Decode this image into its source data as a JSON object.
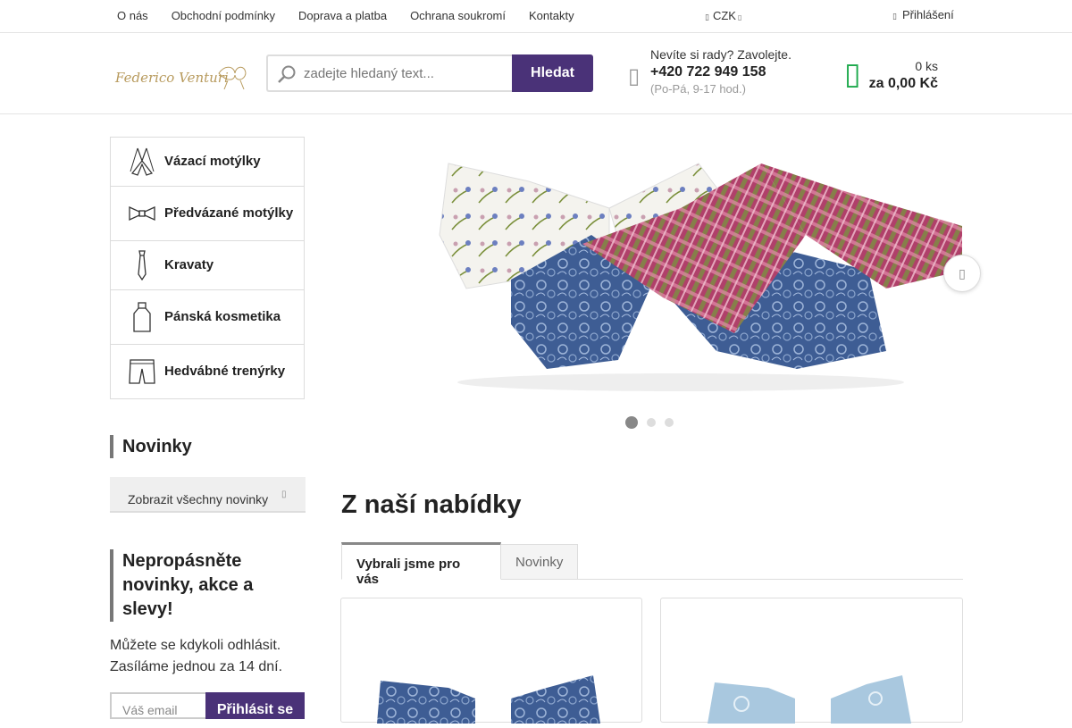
{
  "topnav": {
    "links": [
      "O nás",
      "Obchodní podmínky",
      "Doprava a platba",
      "Ochrana soukromí",
      "Kontakty"
    ],
    "currency": "CZK",
    "login": "Přihlášení"
  },
  "header": {
    "logo_text": "Federico Venturi",
    "search_placeholder": "zadejte hledaný text...",
    "search_button": "Hledat",
    "contact_question": "Nevíte si rady? Zavolejte.",
    "phone": "+420 722 949 158",
    "hours": "(Po-Pá, 9-17 hod.)",
    "cart_count": "0 ks",
    "cart_total": "za 0,00 Kč"
  },
  "categories": [
    {
      "label": "Vázací motýlky",
      "icon": "bow-tie-untied-icon"
    },
    {
      "label": "Předvázané motýlky",
      "icon": "bow-tie-icon"
    },
    {
      "label": "Kravaty",
      "icon": "necktie-icon"
    },
    {
      "label": "Pánská kosmetika",
      "icon": "cosmetics-bottle-icon"
    },
    {
      "label": "Hedvábné trenýrky",
      "icon": "boxer-shorts-icon"
    }
  ],
  "sidebar": {
    "news_title": "Novinky",
    "all_news": "Zobrazit všechny novinky",
    "newsletter_title": "Nepropásněte novinky, akce a slevy!",
    "newsletter_text1": "Můžete se kdykoli odhlásit.",
    "newsletter_text2": "Zasíláme jednou za 14 dní.",
    "email_placeholder": "Váš email",
    "subscribe_button": "Přihlásit se"
  },
  "slider": {
    "active_index": 0,
    "count": 3
  },
  "main": {
    "offer_title": "Z naší nabídky",
    "tabs": [
      "Vybrali jsme pro vás",
      "Novinky"
    ]
  },
  "colors": {
    "brand": "#4a3278",
    "cart": "#1ca94b",
    "border": "#dddddd"
  }
}
